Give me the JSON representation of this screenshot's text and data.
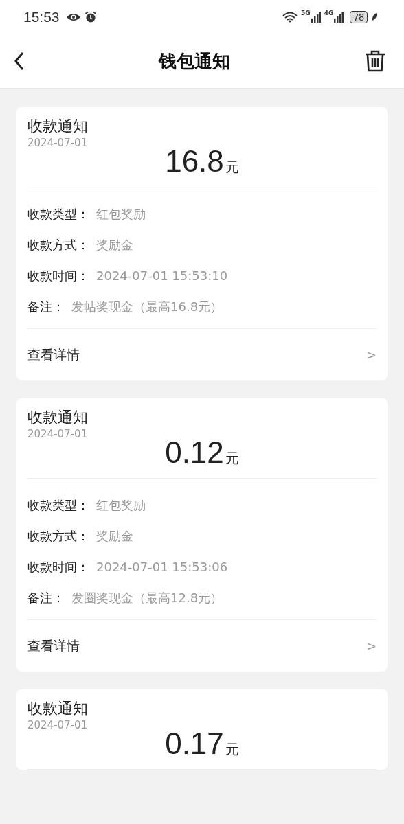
{
  "status_bar": {
    "time": "15:53",
    "network_1": "5G",
    "network_2": "4G",
    "battery": "78"
  },
  "header": {
    "title": "钱包通知"
  },
  "notifications": [
    {
      "title": "收款通知",
      "date": "2024-07-01",
      "amount": "16.8",
      "unit": "元",
      "fields": [
        {
          "label": "收款类型：",
          "value": "红包奖励"
        },
        {
          "label": "收款方式：",
          "value": "奖励金"
        },
        {
          "label": "收款时间：",
          "value": "2024-07-01 15:53:10"
        },
        {
          "label": "备注：",
          "value": "发帖奖现金（最高16.8元）"
        }
      ],
      "link": "查看详情",
      "chevron": ">"
    },
    {
      "title": "收款通知",
      "date": "2024-07-01",
      "amount": "0.12",
      "unit": "元",
      "fields": [
        {
          "label": "收款类型：",
          "value": "红包奖励"
        },
        {
          "label": "收款方式：",
          "value": "奖励金"
        },
        {
          "label": "收款时间：",
          "value": "2024-07-01 15:53:06"
        },
        {
          "label": "备注：",
          "value": "发圈奖现金（最高12.8元）"
        }
      ],
      "link": "查看详情",
      "chevron": ">"
    },
    {
      "title": "收款通知",
      "date": "2024-07-01",
      "amount": "0.17",
      "unit": "元"
    }
  ]
}
